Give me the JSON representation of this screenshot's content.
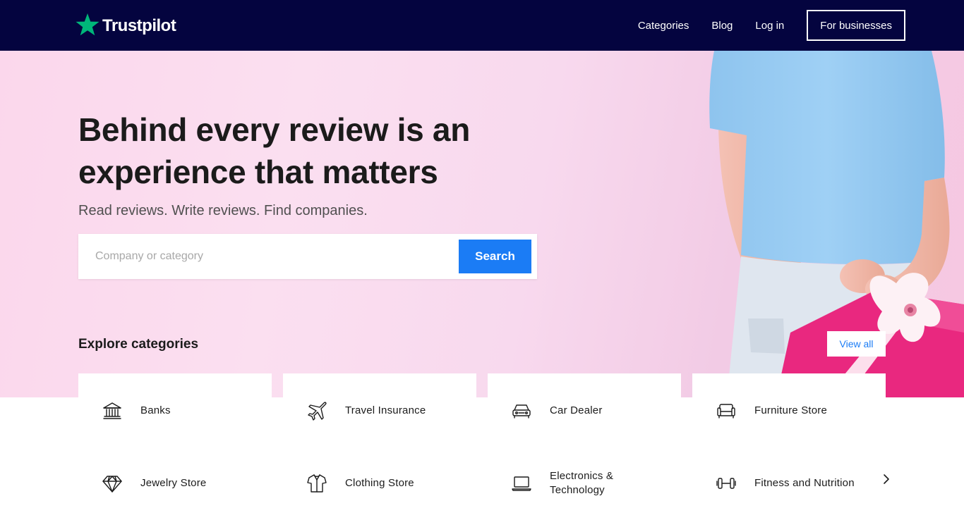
{
  "header": {
    "logo_text": "Trustpilot",
    "nav": {
      "categories": "Categories",
      "blog": "Blog",
      "login": "Log in",
      "for_businesses": "For businesses"
    }
  },
  "hero": {
    "title_line1": "Behind every review is an",
    "title_line2": "experience that matters",
    "subtitle": "Read reviews. Write reviews. Find companies.",
    "search": {
      "placeholder": "Company or category",
      "value": "",
      "button_label": "Search"
    }
  },
  "explore": {
    "title": "Explore categories",
    "view_all_label": "View all",
    "categories": [
      {
        "label": "Banks",
        "icon": "bank-icon"
      },
      {
        "label": "Travel Insurance",
        "icon": "airplane-icon"
      },
      {
        "label": "Car Dealer",
        "icon": "car-icon"
      },
      {
        "label": "Furniture Store",
        "icon": "sofa-icon"
      },
      {
        "label": "Jewelry Store",
        "icon": "diamond-icon"
      },
      {
        "label": "Clothing Store",
        "icon": "shirt-icon"
      },
      {
        "label": "Electronics & Technology",
        "icon": "laptop-icon"
      },
      {
        "label": "Fitness and Nutrition",
        "icon": "dumbbell-icon"
      }
    ],
    "next_icon": "chevron-right-icon"
  },
  "colors": {
    "header_bg": "#04043f",
    "brand_green": "#00b67a",
    "accent_blue": "#1b7cf5",
    "hero_pink": "#fbd7ec",
    "gift_pink": "#e9287f"
  }
}
